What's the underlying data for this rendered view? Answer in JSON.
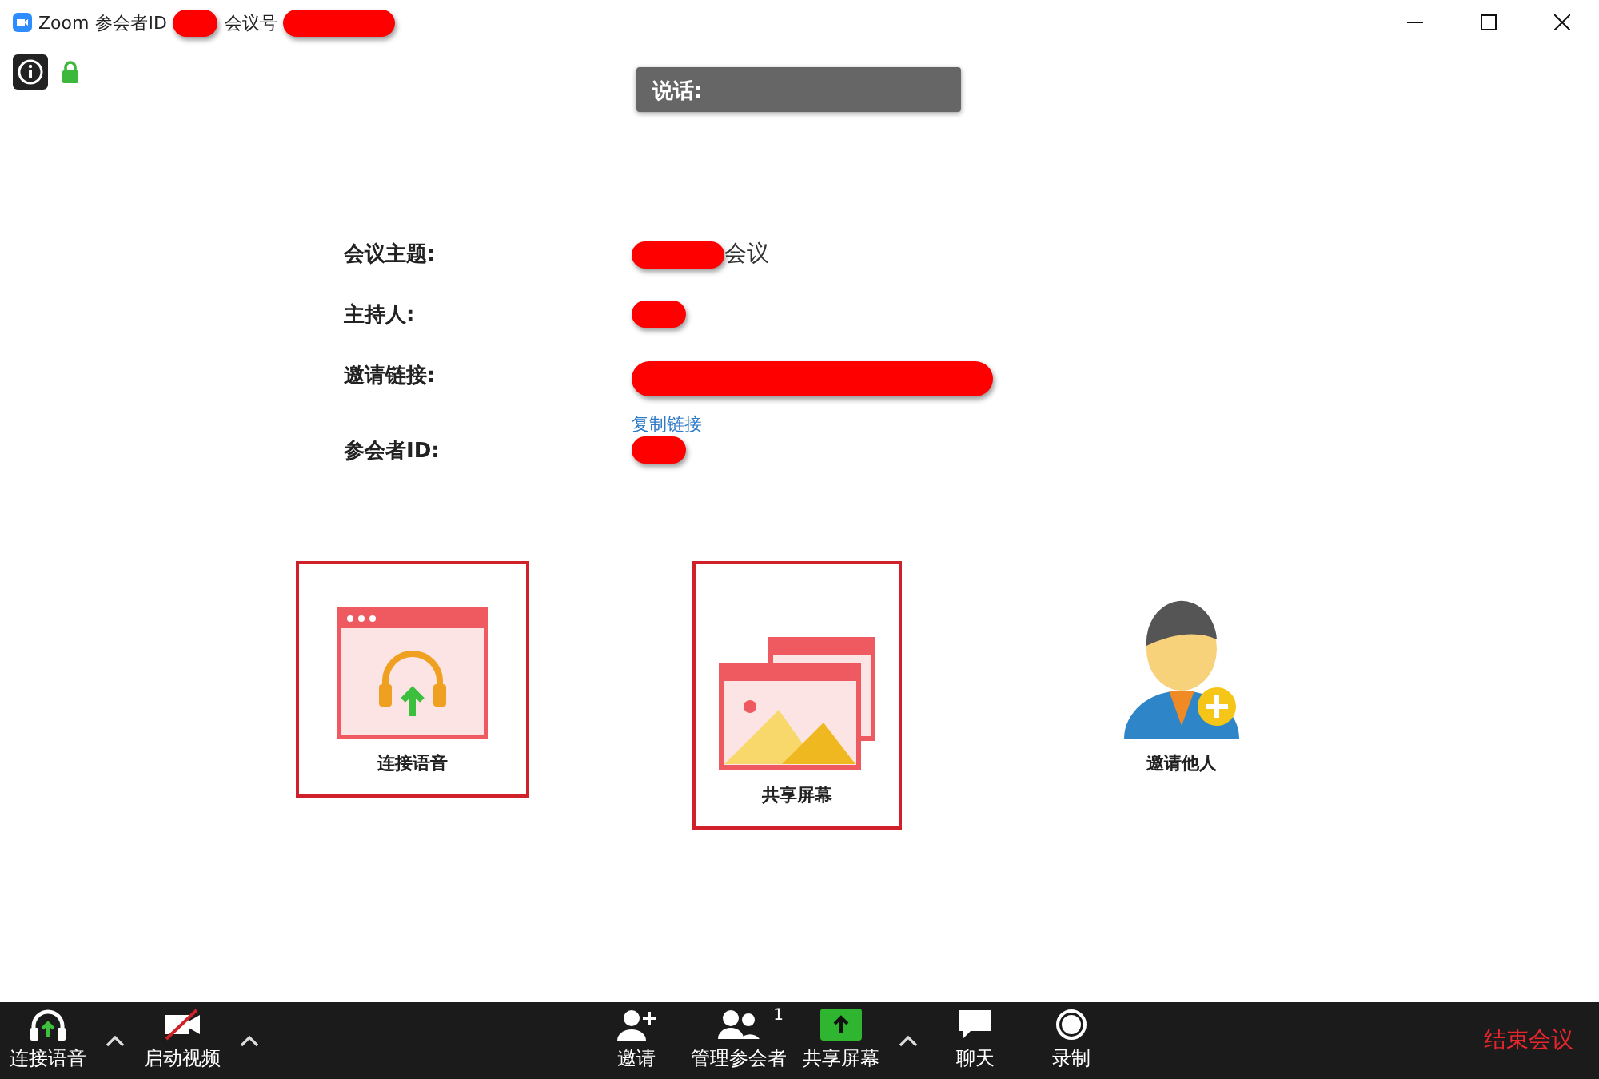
{
  "window": {
    "app": "Zoom",
    "segments": [
      {
        "label": "参会者ID",
        "redacted": true
      },
      {
        "label": "会议号",
        "redacted": true
      }
    ]
  },
  "speaking": {
    "label": "说话:"
  },
  "info": [
    {
      "label": "会议主题:",
      "value": "会议",
      "redacted": true
    },
    {
      "label": "主持人:",
      "redacted": true
    },
    {
      "label": "邀请链接:",
      "redacted": true,
      "link": "复制链接"
    },
    {
      "label": "参会者ID:",
      "redacted": true
    }
  ],
  "actions": [
    {
      "kind": "audio",
      "label": "连接语音",
      "highlighted": true
    },
    {
      "kind": "share",
      "label": "共享屏幕",
      "highlighted": true
    },
    {
      "kind": "invite",
      "label": "邀请他人",
      "highlighted": false
    }
  ],
  "toolbar_left": [
    {
      "kind": "audio",
      "label": "连接语音",
      "caret": true
    },
    {
      "kind": "video",
      "label": "启动视频",
      "caret": true
    }
  ],
  "toolbar_center": [
    {
      "kind": "invite",
      "label": "邀请",
      "caret": false
    },
    {
      "kind": "participants",
      "label": "管理参会者",
      "badge": "1",
      "caret": false
    },
    {
      "kind": "share",
      "label": "共享屏幕",
      "caret": true
    },
    {
      "kind": "chat",
      "label": "聊天",
      "caret": false
    },
    {
      "kind": "record",
      "label": "录制",
      "caret": false
    }
  ],
  "end_button": "结束会议"
}
